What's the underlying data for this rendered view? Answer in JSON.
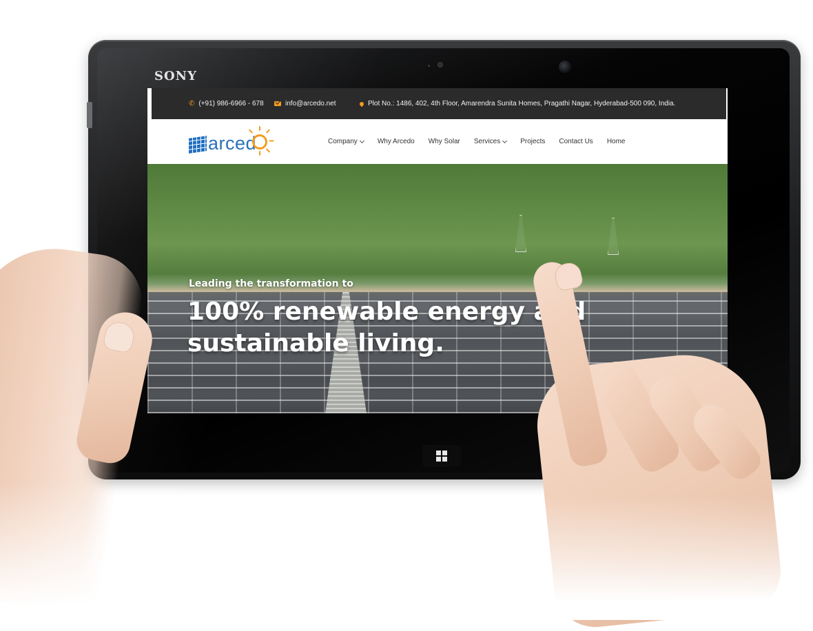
{
  "device": {
    "brand": "SONY"
  },
  "website": {
    "topbar": {
      "phone": "(+91) 986-6966 - 678",
      "email": "info@arcedo.net",
      "address": "Plot No.: 1486, 402, 4th Floor, Amarendra Sunita Homes, Pragathi Nagar, Hyderabad-500 090, India."
    },
    "logo": {
      "text": "arced"
    },
    "nav": {
      "items": [
        {
          "label": "Company",
          "dropdown": true
        },
        {
          "label": "Why Arcedo",
          "dropdown": false
        },
        {
          "label": "Why Solar",
          "dropdown": false
        },
        {
          "label": "Services",
          "dropdown": true
        },
        {
          "label": "Projects",
          "dropdown": false
        },
        {
          "label": "Contact Us",
          "dropdown": false
        },
        {
          "label": "Home",
          "dropdown": false
        }
      ]
    },
    "hero": {
      "subtitle": "Leading the transformation to",
      "title": "100% renewable energy and sustainable living."
    }
  },
  "colors": {
    "accent": "#f39c1f",
    "brand_blue": "#2b71b8",
    "topbar_bg": "#2b2b2b"
  },
  "icons": [
    "phone-icon",
    "mail-icon",
    "map-pin-icon",
    "solar-panel-icon",
    "sun-icon",
    "chevron-down-icon",
    "windows-logo-icon"
  ]
}
